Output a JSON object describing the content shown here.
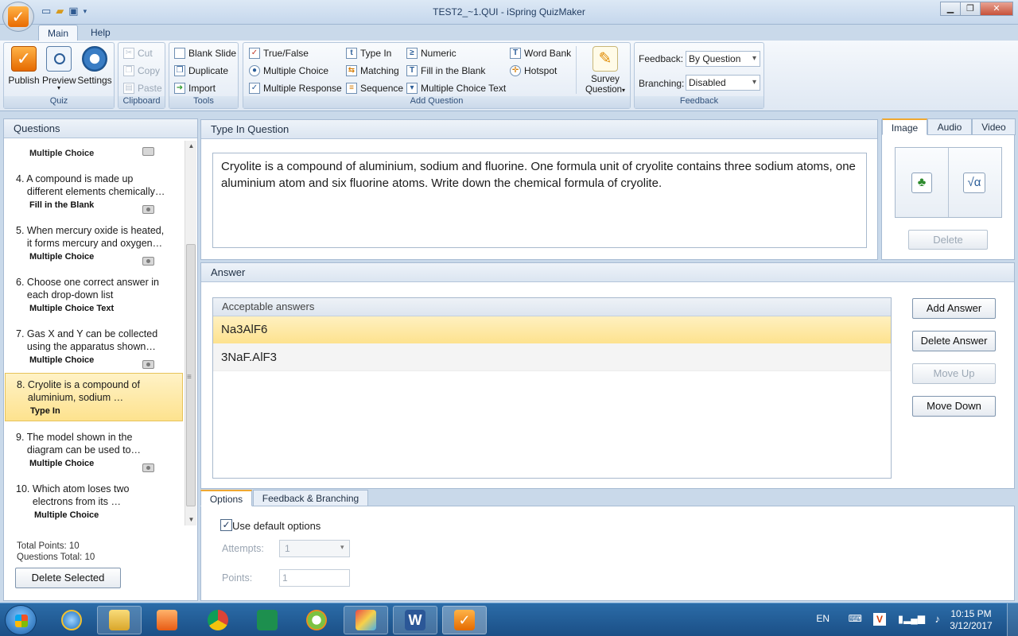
{
  "window": {
    "title": "TEST2_~1.QUI - iSpring QuizMaker"
  },
  "ribbon": {
    "tabs": [
      "Main",
      "Help"
    ],
    "quiz_group": {
      "label": "Quiz",
      "publish": "Publish",
      "preview": "Preview",
      "settings": "Settings"
    },
    "clipboard_group": {
      "label": "Clipboard",
      "cut": "Cut",
      "copy": "Copy",
      "paste": "Paste"
    },
    "tools_group": {
      "label": "Tools",
      "blank_slide": "Blank Slide",
      "duplicate": "Duplicate",
      "import": "Import"
    },
    "add_question_group": {
      "label": "Add Question",
      "true_false": "True/False",
      "multiple_choice": "Multiple Choice",
      "multiple_response": "Multiple Response",
      "type_in": "Type In",
      "matching": "Matching",
      "sequence": "Sequence",
      "numeric": "Numeric",
      "fill_in_blank": "Fill in the Blank",
      "multiple_choice_text": "Multiple Choice Text",
      "word_bank": "Word Bank",
      "hotspot": "Hotspot",
      "survey_line1": "Survey",
      "survey_line2": "Question"
    },
    "feedback_group": {
      "label": "Feedback",
      "feedback_label": "Feedback:",
      "feedback_value": "By Question",
      "branching_label": "Branching:",
      "branching_value": "Disabled"
    }
  },
  "questions_panel": {
    "title": "Questions",
    "partial_top": {
      "type": "Multiple Choice"
    },
    "items": [
      {
        "num": "4.",
        "line1": "A compound is made up",
        "line2": "different elements chemically…",
        "type": "Fill in the Blank",
        "has_image": true,
        "selected": false
      },
      {
        "num": "5.",
        "line1": "When mercury oxide is heated,",
        "line2": "it forms mercury and oxygen…",
        "type": "Multiple Choice",
        "has_image": true,
        "selected": false
      },
      {
        "num": "6.",
        "line1": "Choose one correct answer in",
        "line2": "each drop-down list",
        "type": "Multiple Choice Text",
        "has_image": false,
        "selected": false
      },
      {
        "num": "7.",
        "line1": "Gas X and Y can be collected",
        "line2": "using the apparatus shown…",
        "type": "Multiple Choice",
        "has_image": true,
        "selected": false
      },
      {
        "num": "8.",
        "line1": "Cryolite is a compound of",
        "line2": "aluminium, sodium …",
        "type": "Type In",
        "has_image": false,
        "selected": true
      },
      {
        "num": "9.",
        "line1": "The model shown in the",
        "line2": "diagram can be used to…",
        "type": "Multiple Choice",
        "has_image": true,
        "selected": false
      },
      {
        "num": "10.",
        "line1": "Which atom loses two",
        "line2": "electrons from its …",
        "type": "Multiple Choice",
        "has_image": false,
        "selected": false
      }
    ],
    "total_points": "Total Points: 10",
    "questions_total": "Questions Total: 10",
    "delete_selected": "Delete Selected"
  },
  "question_panel": {
    "title": "Type In Question",
    "text": "Cryolite is a compound of aluminium, sodium and fluorine. One formula unit of cryolite contains three sodium atoms, one aluminium atom and six fluorine atoms. Write down the chemical formula of cryolite."
  },
  "media_panel": {
    "tabs": [
      "Image",
      "Audio",
      "Video"
    ],
    "delete": "Delete"
  },
  "answer_panel": {
    "title": "Answer",
    "header": "Acceptable answers",
    "answers": [
      "Na3AlF6",
      "3NaF.AlF3"
    ],
    "buttons": {
      "add": "Add Answer",
      "delete": "Delete Answer",
      "move_up": "Move Up",
      "move_down": "Move Down"
    }
  },
  "options_panel": {
    "tabs": [
      "Options",
      "Feedback & Branching"
    ],
    "use_default": "Use default options",
    "attempts_label": "Attempts:",
    "attempts_value": "1",
    "points_label": "Points:",
    "points_value": "1"
  },
  "tray": {
    "lang": "EN",
    "time": "10:15 PM",
    "date": "3/12/2017"
  },
  "colors": {
    "selection": "#fde28e",
    "accent_orange": "#f0a830",
    "taskbar": "#1b4f86"
  }
}
